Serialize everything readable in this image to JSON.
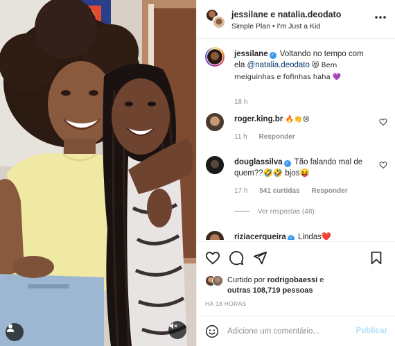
{
  "header": {
    "title": "jessilane e natalia.deodato",
    "music": "Simple Plan • I'm Just a Kid"
  },
  "caption": {
    "username": "jessilane",
    "text_1": "Voltando no tempo com ela ",
    "mention": "@natalia.deodato",
    "text_2": " 😻 Bem meiguinhas e fofinhas haha 💜",
    "time": "18 h"
  },
  "comments": [
    {
      "username": "roger.king.br",
      "text": "🔥👏😢",
      "time": "11 h",
      "reply_label": "Responder"
    },
    {
      "username": "douglassilva",
      "text": "Tão falando mal de quem??🤣🤣 bjos😝",
      "time": "17 h",
      "likes": "541 curtidas",
      "reply_label": "Responder",
      "view_replies": "Ver respostas (48)"
    },
    {
      "username": "riziacerqueira",
      "text": "Lindas❤️"
    }
  ],
  "likes": {
    "prefix": "Curtido por ",
    "by": "rodrigobaessi",
    "mid": " e",
    "others": "outras 108,719 pessoas"
  },
  "time_ago": "HÁ 18 HORAS",
  "add_comment": {
    "placeholder": "Adicione um comentário...",
    "publish": "Publicar"
  },
  "icons": {
    "more": "more-icon",
    "heart": "heart-icon",
    "comment": "comment-icon",
    "share": "share-icon",
    "save": "bookmark-icon",
    "emoji": "emoji-icon",
    "user": "user-icon",
    "mute": "mute-icon",
    "verified": "verified-icon"
  },
  "colors": {
    "link": "#00376b",
    "muted": "#8e8e8e",
    "verified": "#3897f0",
    "publish_disabled": "#b2dffc",
    "heart_emoji": "#8e44ad"
  }
}
